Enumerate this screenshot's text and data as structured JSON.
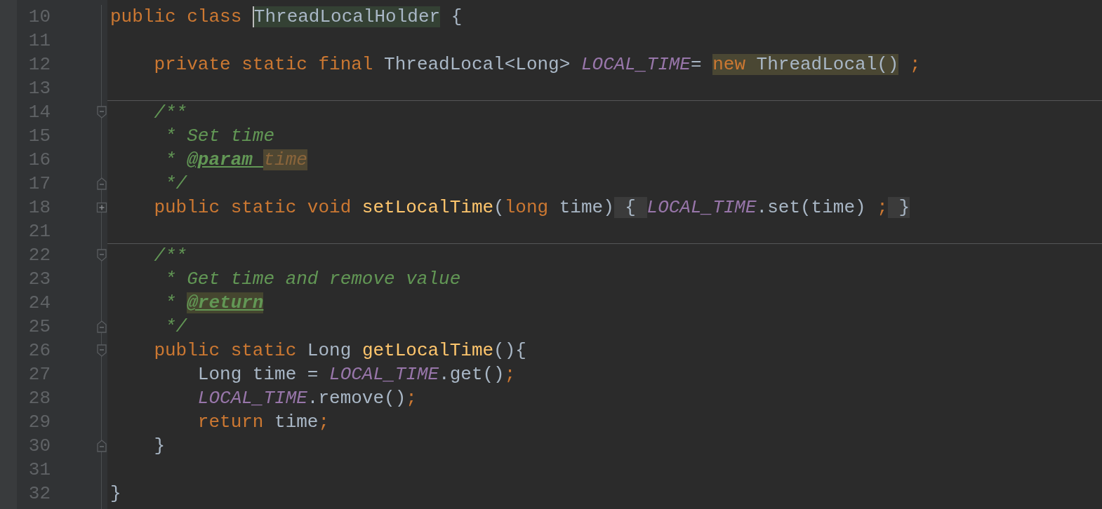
{
  "editor": {
    "lines": [
      {
        "number": "10",
        "separator_above": false,
        "tokens": [
          {
            "text": "public class ",
            "kind": "keyword"
          },
          {
            "text": "ThreadLocalHolder",
            "kind": "plain",
            "highlight": {
              "kind": "declaration"
            },
            "caret": true
          },
          {
            "text": " {",
            "kind": "plain"
          }
        ]
      },
      {
        "number": "11",
        "separator_above": false
      },
      {
        "number": "12",
        "separator_above": false,
        "tokens": [
          {
            "text": "    private static final ",
            "kind": "keyword"
          },
          {
            "text": "ThreadLocal<Long> ",
            "kind": "plain"
          },
          {
            "text": "LOCAL_TIME",
            "kind": "constant"
          },
          {
            "text": "= ",
            "kind": "plain"
          },
          {
            "text": "new ",
            "kind": "keyword",
            "highlight": {
              "kind": "usage"
            }
          },
          {
            "text": "ThreadLocal()",
            "kind": "plain",
            "highlight": {
              "kind": "usage"
            }
          },
          {
            "text": " ;",
            "kind": "keyword"
          }
        ]
      },
      {
        "number": "13",
        "separator_above": false
      },
      {
        "number": "14",
        "fold": {
          "kind": "start"
        },
        "separator_above": true,
        "tokens": [
          {
            "text": "    /**",
            "kind": "comment"
          }
        ]
      },
      {
        "number": "15",
        "separator_above": false,
        "tokens": [
          {
            "text": "     * Set time",
            "kind": "comment"
          }
        ]
      },
      {
        "number": "16",
        "separator_above": false,
        "tokens": [
          {
            "text": "     * ",
            "kind": "comment"
          },
          {
            "text": "@param ",
            "kind": "doc_tag"
          },
          {
            "text": "time",
            "kind": "doc_param",
            "highlight": {
              "kind": "param"
            }
          }
        ]
      },
      {
        "number": "17",
        "fold": {
          "kind": "end"
        },
        "separator_above": false,
        "tokens": [
          {
            "text": "     */",
            "kind": "comment"
          }
        ]
      },
      {
        "number": "18",
        "fold": {
          "kind": "collapsed"
        },
        "separator_above": false,
        "tokens": [
          {
            "text": "    public static void ",
            "kind": "keyword"
          },
          {
            "text": "setLocalTime",
            "kind": "method"
          },
          {
            "text": "(",
            "kind": "plain"
          },
          {
            "text": "long ",
            "kind": "keyword"
          },
          {
            "text": "time)",
            "kind": "plain"
          },
          {
            "text": " { ",
            "kind": "plain",
            "highlight": {
              "kind": "folded"
            }
          },
          {
            "text": "LOCAL_TIME",
            "kind": "constant"
          },
          {
            "text": ".set(time) ",
            "kind": "plain"
          },
          {
            "text": ";",
            "kind": "keyword"
          },
          {
            "text": " }",
            "kind": "plain",
            "highlight": {
              "kind": "folded"
            }
          }
        ]
      },
      {
        "number": "21",
        "separator_above": false
      },
      {
        "number": "22",
        "fold": {
          "kind": "start"
        },
        "separator_above": true,
        "tokens": [
          {
            "text": "    /**",
            "kind": "comment"
          }
        ]
      },
      {
        "number": "23",
        "separator_above": false,
        "tokens": [
          {
            "text": "     * Get time and remove value",
            "kind": "comment"
          }
        ]
      },
      {
        "number": "24",
        "separator_above": false,
        "tokens": [
          {
            "text": "     * ",
            "kind": "comment"
          },
          {
            "text": "@return",
            "kind": "doc_tag",
            "highlight": {
              "kind": "tag"
            }
          }
        ]
      },
      {
        "number": "25",
        "fold": {
          "kind": "end"
        },
        "separator_above": false,
        "tokens": [
          {
            "text": "     */",
            "kind": "comment"
          }
        ]
      },
      {
        "number": "26",
        "fold": {
          "kind": "start"
        },
        "separator_above": false,
        "tokens": [
          {
            "text": "    public static ",
            "kind": "keyword"
          },
          {
            "text": "Long ",
            "kind": "plain"
          },
          {
            "text": "getLocalTime",
            "kind": "method"
          },
          {
            "text": "(){",
            "kind": "plain"
          }
        ]
      },
      {
        "number": "27",
        "separator_above": false,
        "tokens": [
          {
            "text": "        Long time = ",
            "kind": "plain"
          },
          {
            "text": "LOCAL_TIME",
            "kind": "constant"
          },
          {
            "text": ".get()",
            "kind": "plain"
          },
          {
            "text": ";",
            "kind": "keyword"
          }
        ]
      },
      {
        "number": "28",
        "separator_above": false,
        "tokens": [
          {
            "text": "        LOCAL_TIME",
            "kind": "constant"
          },
          {
            "text": ".remove()",
            "kind": "plain"
          },
          {
            "text": ";",
            "kind": "keyword"
          }
        ]
      },
      {
        "number": "29",
        "separator_above": false,
        "tokens": [
          {
            "text": "        return ",
            "kind": "keyword"
          },
          {
            "text": "time",
            "kind": "plain"
          },
          {
            "text": ";",
            "kind": "keyword"
          }
        ]
      },
      {
        "number": "30",
        "fold": {
          "kind": "end"
        },
        "separator_above": false,
        "tokens": [
          {
            "text": "    }",
            "kind": "plain"
          }
        ]
      },
      {
        "number": "31",
        "separator_above": false
      },
      {
        "number": "32",
        "separator_above": false,
        "tokens": [
          {
            "text": "}",
            "kind": "plain"
          }
        ]
      }
    ]
  }
}
